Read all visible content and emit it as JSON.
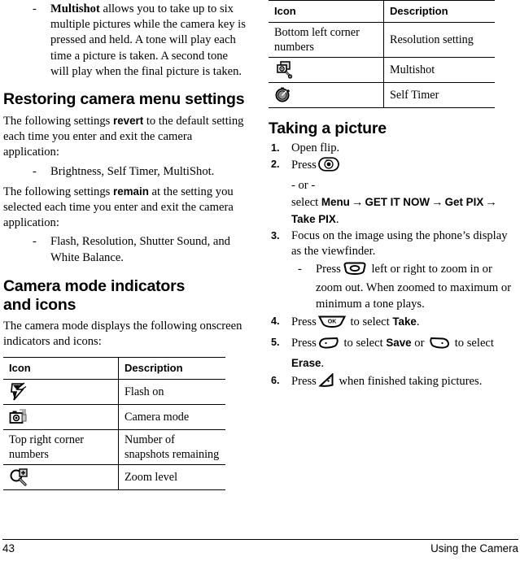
{
  "page": {
    "number": "43",
    "section": "Using the Camera"
  },
  "left_column": {
    "intro_bullet": {
      "dash": "-",
      "bold_lead": "Multishot",
      "text": " allows you to take up to six multiple pictures while the camera key is pressed and held. A tone will play each time a picture is taken. A second tone will play when the final picture is taken."
    },
    "heading_restoring": "Restoring camera menu settings",
    "para_revert_a": "The following settings ",
    "para_revert_bold": "revert",
    "para_revert_b": " to the default setting each time you enter and exit the camera application:",
    "bullet_revert": {
      "dash": "-",
      "text": "Brightness, Self Timer, MultiShot."
    },
    "para_remain_a": "The following settings ",
    "para_remain_bold": "remain",
    "para_remain_b": " at the setting you selected each time you enter and exit the camera application:",
    "bullet_remain": {
      "dash": "-",
      "text": "Flash, Resolution, Shutter Sound, and White Balance."
    },
    "heading_indicators_line1": "Camera mode indicators",
    "heading_indicators_line2": "and icons",
    "para_indicators": "The camera mode displays the following onscreen indicators and icons:",
    "table": {
      "headers": [
        "Icon",
        "Description"
      ],
      "rows": [
        {
          "icon": "flash-on-icon",
          "icon_text": "",
          "description": "Flash on"
        },
        {
          "icon": "camera-mode-icon",
          "icon_text": "",
          "description": "Camera mode"
        },
        {
          "icon": "",
          "icon_text": "Top right corner numbers",
          "description": "Number of snapshots remaining"
        },
        {
          "icon": "zoom-level-icon",
          "icon_text": "",
          "description": "Zoom level"
        }
      ]
    }
  },
  "right_column": {
    "table": {
      "headers": [
        "Icon",
        "Description"
      ],
      "rows": [
        {
          "icon": "",
          "icon_text": "Bottom left corner numbers",
          "description": "Resolution setting"
        },
        {
          "icon": "multishot-icon",
          "icon_text": "",
          "description": "Multishot"
        },
        {
          "icon": "self-timer-icon",
          "icon_text": "",
          "description": "Self Timer"
        }
      ]
    },
    "heading_taking": "Taking a picture",
    "steps": [
      {
        "num": "1.",
        "text": "Open flip."
      },
      {
        "num": "2.",
        "press_label": "Press",
        "key_icon": "camera-key-icon",
        "or_text": "- or -",
        "select_label": "select ",
        "menu_1": "Menu",
        "arrow": "→",
        "menu_2": "GET IT NOW",
        "menu_3": "Get PIX",
        "menu_4": "Take PIX",
        "period": "."
      },
      {
        "num": "3.",
        "text": "Focus on the image using the phone’s display as the viewfinder.",
        "sub": {
          "dash": "-",
          "press_label": "Press",
          "key_icon": "nav-key-icon",
          "text": " left or right to zoom in or zoom out. When zoomed to maximum or minimum a tone plays."
        }
      },
      {
        "num": "4.",
        "press_label": "Press",
        "key_icon": "ok-key-icon",
        "mid_text": " to select ",
        "bold_word": "Take",
        "period": "."
      },
      {
        "num": "5.",
        "press_label": "Press",
        "key_icon_left": "left-softkey-icon",
        "mid_text_1": " to select ",
        "bold_word_1": "Save",
        "mid_text_2": " or ",
        "key_icon_right": "right-softkey-icon",
        "mid_text_3": " to select ",
        "bold_word_2": "Erase",
        "period": "."
      },
      {
        "num": "6.",
        "press_label": "Press",
        "key_icon": "end-key-icon",
        "text": " when finished taking pictures."
      }
    ]
  }
}
